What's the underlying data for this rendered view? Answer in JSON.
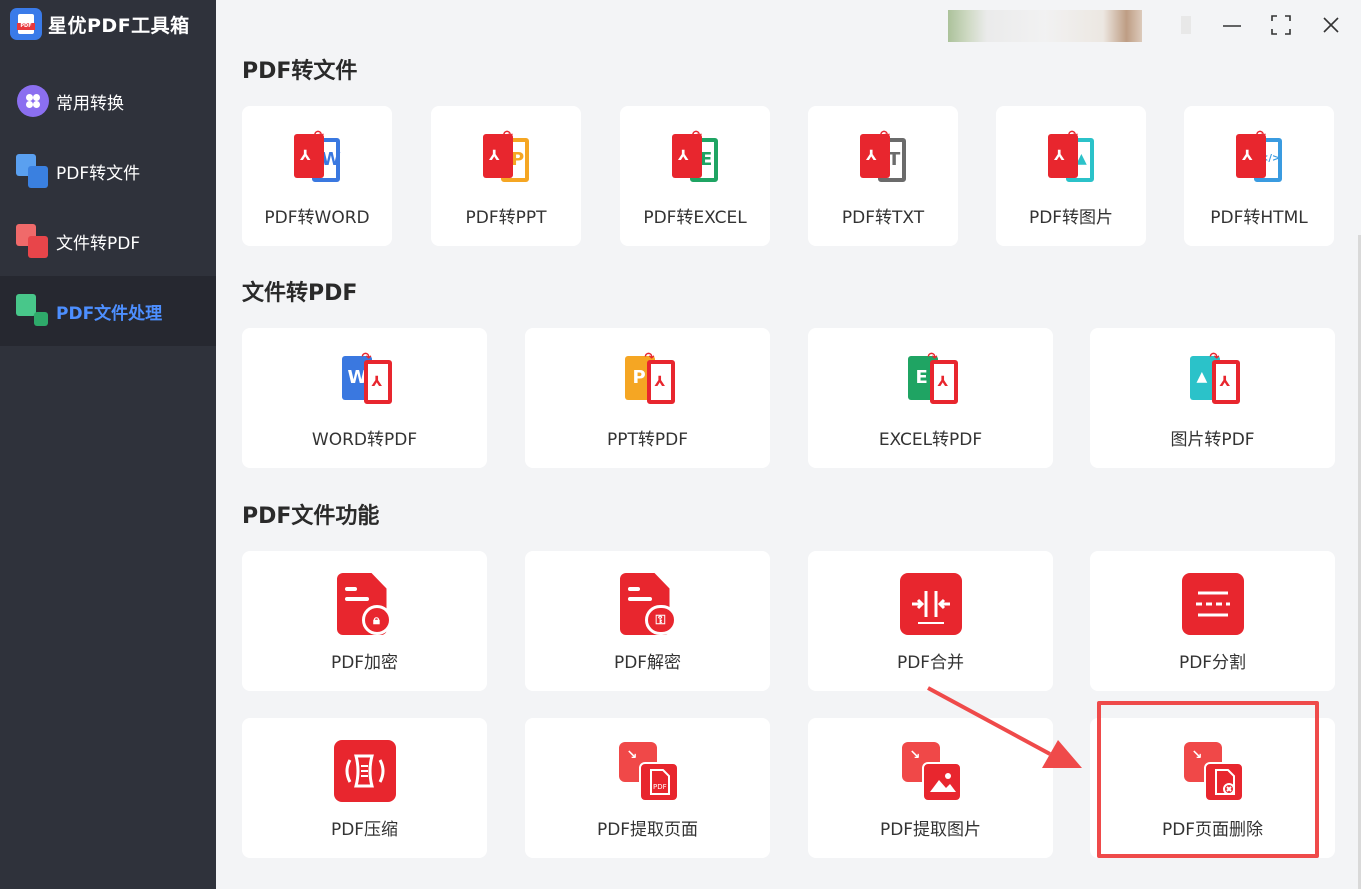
{
  "app": {
    "title": "星优PDF工具箱"
  },
  "sidebar": {
    "items": [
      {
        "label": "常用转换",
        "active": false
      },
      {
        "label": "PDF转文件",
        "active": false
      },
      {
        "label": "文件转PDF",
        "active": false
      },
      {
        "label": "PDF文件处理",
        "active": true
      }
    ]
  },
  "window": {
    "controls": [
      "minimize-icon",
      "maximize-icon",
      "close-icon"
    ]
  },
  "sections": {
    "pdf_to_file": {
      "title": "PDF转文件",
      "cards": [
        "PDF转WORD",
        "PDF转PPT",
        "PDF转EXCEL",
        "PDF转TXT",
        "PDF转图片",
        "PDF转HTML"
      ]
    },
    "file_to_pdf": {
      "title": "文件转PDF",
      "cards": [
        "WORD转PDF",
        "PPT转PDF",
        "EXCEL转PDF",
        "图片转PDF"
      ]
    },
    "pdf_features": {
      "title": "PDF文件功能",
      "cards": [
        "PDF加密",
        "PDF解密",
        "PDF合并",
        "PDF分割",
        "PDF压缩",
        "PDF提取页面",
        "PDF提取图片",
        "PDF页面删除"
      ]
    }
  },
  "colors": {
    "sidebar_bg": "#2f323b",
    "active_nav": "#4d8fff",
    "accent_red": "#e8262e",
    "word": "#3a78e0",
    "ppt": "#f5a623",
    "excel": "#1fa463",
    "txt": "#6b6b6b",
    "image": "#2bc2c9",
    "html": "#3a9be0",
    "highlight": "#ef4a4a"
  }
}
